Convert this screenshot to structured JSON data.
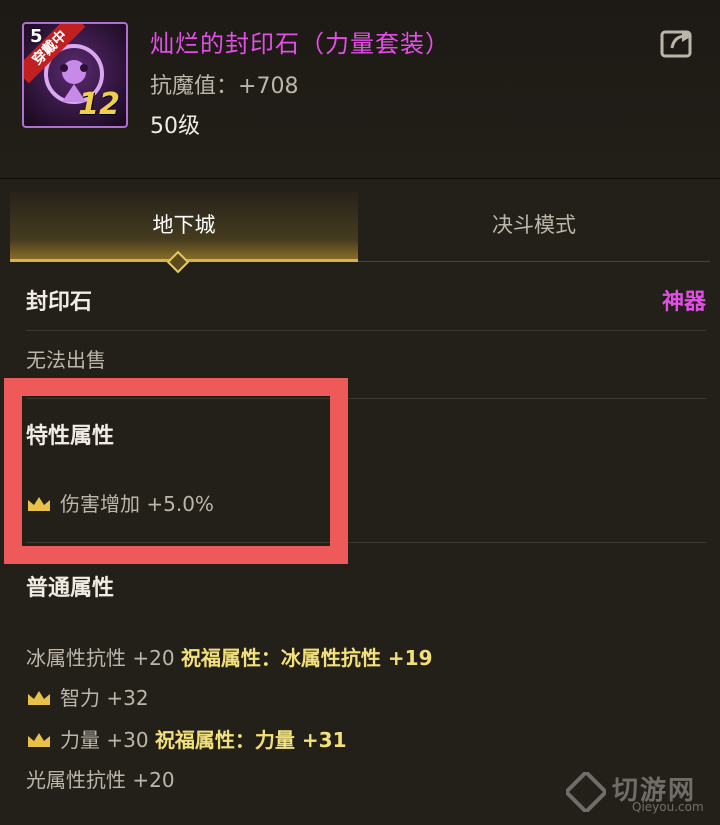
{
  "item": {
    "icon_level": "5",
    "equipped_badge": "穿戴中",
    "plus_level": "12",
    "title": "灿烂的封印石（力量套装）",
    "stat_label": "抗魔值：",
    "stat_value": "+708",
    "level_text": "50级"
  },
  "tabs": [
    {
      "label": "地下城",
      "active": true
    },
    {
      "label": "决斗模式",
      "active": false
    }
  ],
  "info": {
    "category": "封印石",
    "rarity": "神器",
    "sell_note": "无法出售"
  },
  "trait_section": {
    "title": "特性属性",
    "lines": [
      {
        "icon": "crown-icon",
        "text": "伤害增加 +5.0%"
      }
    ]
  },
  "normal_section": {
    "title": "普通属性",
    "lines": [
      {
        "text": "冰属性抗性 +20",
        "blessing": "祝福属性：冰属性抗性 +19"
      },
      {
        "icon": "crown-icon",
        "text": "智力 +32"
      },
      {
        "icon": "crown-icon",
        "text": "力量 +30",
        "blessing": "祝福属性：力量 +31"
      },
      {
        "text": "光属性抗性 +20"
      }
    ]
  },
  "watermark": {
    "text": "切游网",
    "sub": "Qieyou.com"
  },
  "colors": {
    "legendary_purple": "#e24ee6",
    "blessing_yellow": "#f2e07a",
    "highlight_red": "#ee5a5a",
    "tab_gold": "#d9b246"
  }
}
